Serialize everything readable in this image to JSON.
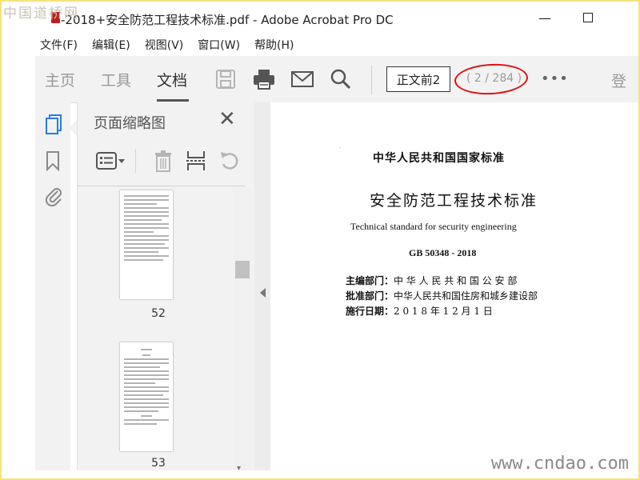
{
  "window": {
    "title": "-2018+安全防范工程技术标准.pdf - Adobe Acrobat Pro DC",
    "minimize_glyph": "—"
  },
  "watermark": {
    "top": "中国道桥网",
    "bottom": "www.cndao.com"
  },
  "menu": [
    "文件(F)",
    "编辑(E)",
    "视图(V)",
    "窗口(W)",
    "帮助(H)"
  ],
  "toolbar": {
    "tabs": [
      "主页",
      "工具",
      "文档"
    ],
    "active_tab": "文档",
    "icons": [
      "save-icon",
      "print-icon",
      "email-icon",
      "search-icon"
    ],
    "page_label": "正文前2",
    "page_count": "( 2 / 284 )",
    "more": "•••",
    "signin_partial": "登"
  },
  "panel": {
    "title": "页面缩略图",
    "close": "✕",
    "tools": [
      "options-menu-icon",
      "delete-icon",
      "extract-icon",
      "rotate-icon"
    ],
    "thumbnails": [
      {
        "number": "52"
      },
      {
        "number": "53"
      }
    ]
  },
  "rail": [
    "pages-icon",
    "bookmark-icon",
    "attachment-icon"
  ],
  "document": {
    "tick": "·",
    "header": "中华人民共和国国家标准",
    "title": "安全防范工程技术标准",
    "english_title": "Technical standard for security engineering",
    "code": "GB 50348 - 2018",
    "lines": [
      {
        "label": "主编部门：",
        "value": "中 华 人 民 共 和 国 公 安 部"
      },
      {
        "label": "批准部门：",
        "value": "中华人民共和国住房和城乡建设部"
      },
      {
        "label": "施行日期：",
        "value": "2 0 1 8   年   1 2   月   1   日"
      }
    ]
  },
  "colors": {
    "frame": "#f7e27a",
    "highlight": "#e01010",
    "toolbar_bg": "#f2f2f2",
    "accent_icon": "#2a7de1"
  }
}
